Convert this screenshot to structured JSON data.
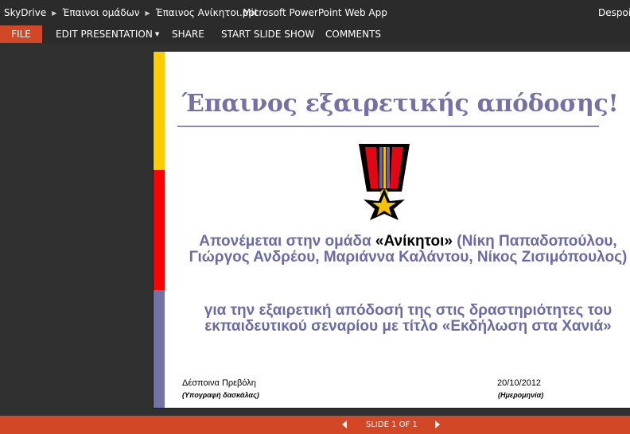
{
  "titlebar": {
    "breadcrumbs": [
      "SkyDrive",
      "Έπαινοι ομάδων",
      "Έπαινος Ανίκητοι.ppt"
    ],
    "app_title": "Microsoft PowerPoint Web App",
    "user": "Despoi"
  },
  "menu": {
    "file": "FILE",
    "edit": "EDIT PRESENTATION",
    "share": "SHARE",
    "slideshow": "START SLIDE SHOW",
    "comments": "COMMENTS"
  },
  "slide": {
    "title": "Έπαινος εξαιρετικής απόδοσης!",
    "award_prefix": "Απονέμεται στην ομάδα ",
    "team": "«Ανίκητοι»",
    "award_suffix": " (Νίκη Παπαδοπούλου, Γιώργος Ανδρέου, Μαριάννα Καλάντου, Νίκος Ζισιμόπουλος)",
    "reason": "για την εξαιρετική απόδοσή της στις δραστηριότητες του εκπαιδευτικού σεναρίου με τίτλο «Εκδήλωση στα Χανιά»",
    "signature_name": "Δέσποινα Πρεβόλη",
    "signature_caption": "(Υπογραφή δασκάλας)",
    "date": "20/10/2012",
    "date_caption": "(Ημερομηνία)",
    "colors": {
      "accent_text": "#6b6aa6",
      "bar_top": "#ffcc00",
      "bar_mid": "#ff0000",
      "bar_bottom": "#7372a6"
    },
    "image": "medal-icon"
  },
  "status": {
    "slide_counter": "SLIDE 1 OF 1",
    "accent": "#d24726"
  }
}
